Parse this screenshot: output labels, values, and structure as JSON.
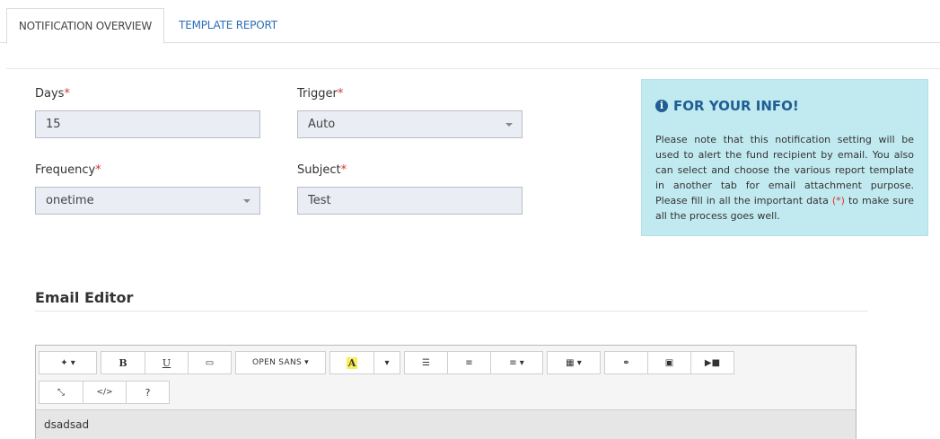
{
  "tabs": [
    {
      "label": "NOTIFICATION OVERVIEW",
      "active": true
    },
    {
      "label": "TEMPLATE REPORT",
      "active": false
    }
  ],
  "form": {
    "days": {
      "label": "Days",
      "value": "15"
    },
    "trigger": {
      "label": "Trigger",
      "value": "Auto"
    },
    "frequency": {
      "label": "Frequency",
      "value": "onetime"
    },
    "subject": {
      "label": "Subject",
      "value": "Test"
    },
    "required_mark": "*"
  },
  "info": {
    "title": "FOR YOUR INFO!",
    "icon": "info-circle-icon",
    "text_before": "Please note that this notification setting will be used to alert the fund recipient by email. You also can select and choose the various report template in another tab for email attachment purpose. Please fill in all the important data ",
    "text_mark": "(*)",
    "text_after": " to make sure all the process goes well."
  },
  "editor": {
    "title": "Email Editor",
    "font_label": "OPEN SANS",
    "bold": "B",
    "underline": "U",
    "codeview": "</>",
    "help": "?",
    "content": "dsadsad"
  }
}
